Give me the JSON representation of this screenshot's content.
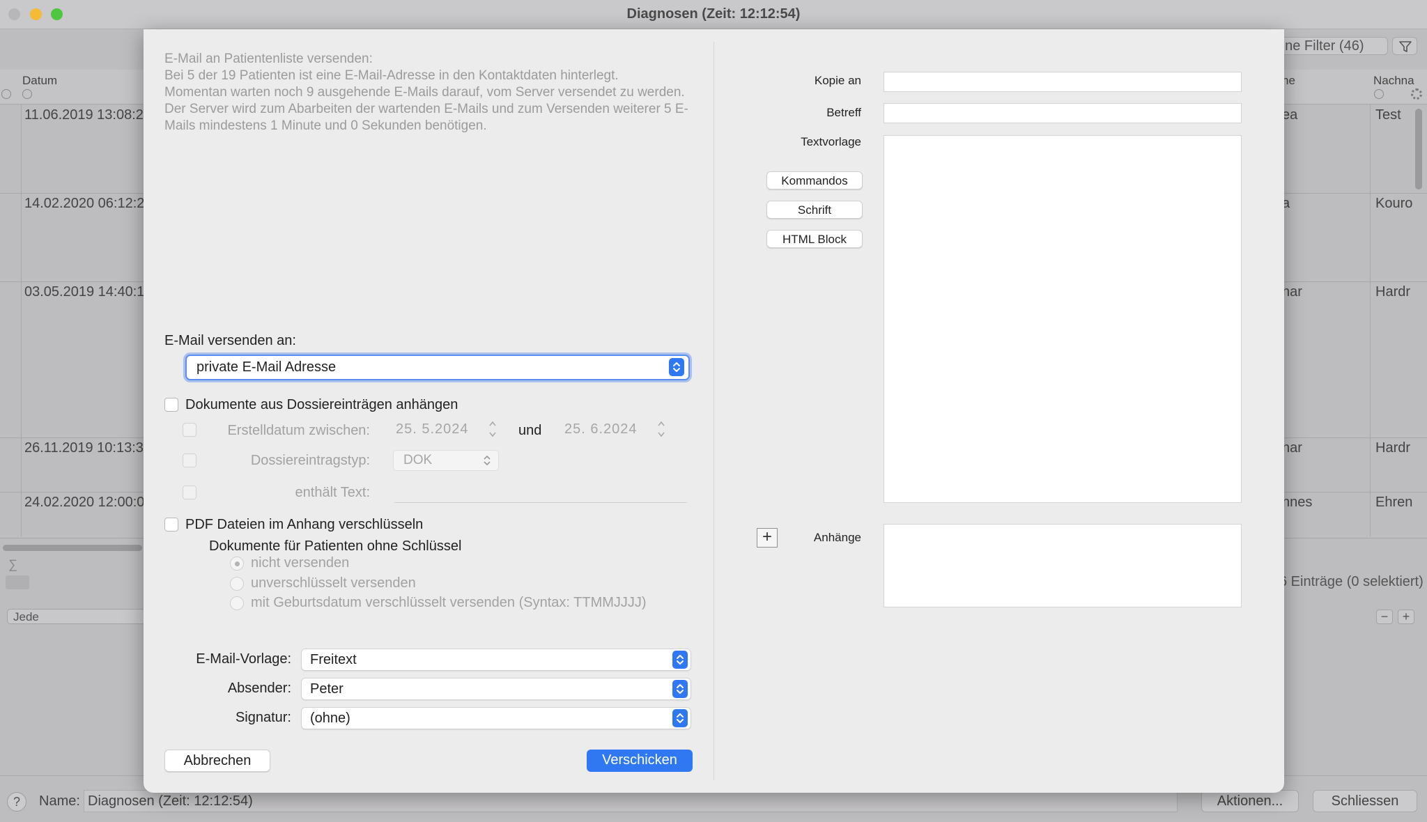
{
  "window": {
    "title": "Diagnosen  (Zeit: 12:12:54)",
    "filter_label": "hne Filter (46)",
    "columns": {
      "date": "Datum",
      "name_partial": "ne",
      "surname": "Nachna"
    },
    "rows": [
      {
        "date": "11.06.2019 13:08:2",
        "mid": "ea",
        "last": "Test"
      },
      {
        "date": "14.02.2020 06:12:2",
        "mid": "a",
        "last": "Kouro"
      },
      {
        "date": "03.05.2019 14:40:1",
        "mid": "nar",
        "last": "Hardr"
      },
      {
        "date": "26.11.2019 10:13:3",
        "mid": "nar",
        "last": "Hardr"
      },
      {
        "date": "24.02.2020 12:00:0",
        "mid": "nnes",
        "last": "Ehren"
      }
    ],
    "sigma": "∑",
    "filter_select": "Jede",
    "entries_count": "6 Einträge (0 selektiert)",
    "minus_label": "−",
    "plus_label": "+",
    "help_label": "?",
    "name_label": "Name:",
    "name_value": "Diagnosen  (Zeit: 12:12:54)",
    "actions_button": "Aktionen...",
    "close_button": "Schliessen"
  },
  "dialog": {
    "info_text": "E-Mail an Patientenliste versenden:\nBei 5 der 19 Patienten ist eine E-Mail-Adresse in den Kontaktdaten hinterlegt.\nMomentan warten noch 9 ausgehende E-Mails darauf, vom Server versendet zu werden. Der Server wird zum Abarbeiten der wartenden E-Mails und zum Versenden weiterer 5 E-Mails mindestens 1 Minute und 0 Sekunden benötigen.",
    "send_to_label": "E-Mail versenden an:",
    "send_to_value": "private E-Mail Adresse",
    "attach_docs_label": "Dokumente aus Dossiereinträgen anhängen",
    "created_between_label": "Erstelldatum zwischen:",
    "date_from": "25.  5.2024",
    "and_label": "und",
    "date_to": "25.  6.2024",
    "entry_type_label": "Dossiereintragstyp:",
    "entry_type_value": "DOK",
    "contains_text_label": "enthält Text:",
    "encrypt_pdf_label": "PDF Dateien im Anhang verschlüsseln",
    "no_key_heading": "Dokumente für Patienten ohne Schlüssel",
    "radio_options": [
      "nicht versenden",
      "unverschlüsselt versenden",
      "mit Geburtsdatum verschlüsselt versenden (Syntax: TTMMJJJJ)"
    ],
    "template_label": "E-Mail-Vorlage:",
    "template_value": "Freitext",
    "sender_label": "Absender:",
    "sender_value": "Peter",
    "signature_label": "Signatur:",
    "signature_value": "(ohne)",
    "cancel_button": "Abbrechen",
    "send_button": "Verschicken",
    "cc_label": "Kopie an",
    "subject_label": "Betreff",
    "text_template_label": "Textvorlage",
    "commands_button": "Kommandos",
    "font_button": "Schrift",
    "html_block_button": "HTML Block",
    "add_attachment_label": "+",
    "attachments_label": "Anhänge"
  },
  "colors": {
    "accent": "#2f78f2",
    "focus_ring": "#5b8ef0"
  }
}
